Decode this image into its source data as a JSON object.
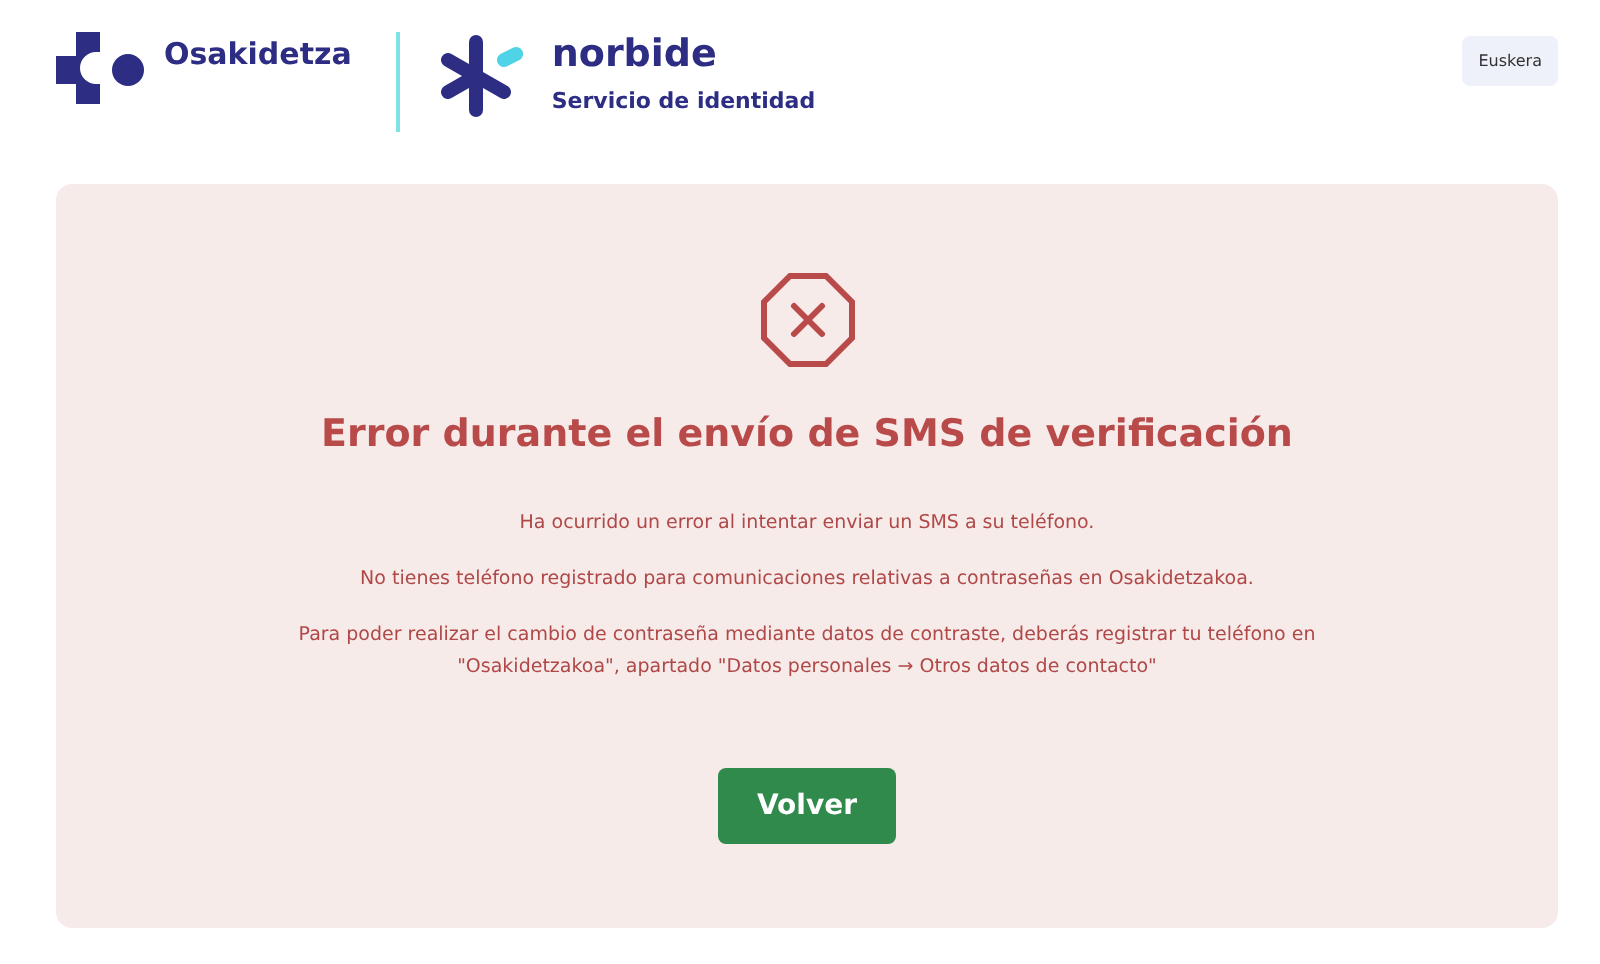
{
  "header": {
    "brand": "Osakidetza",
    "product": "norbide",
    "product_subtitle": "Servicio de identidad",
    "language_button": "Euskera"
  },
  "error": {
    "title": "Error durante el envío de SMS de verificación",
    "messages": [
      "Ha ocurrido un error al intentar enviar un SMS a su teléfono.",
      "No tienes teléfono registrado para comunicaciones relativas a contraseñas en Osakidetzakoa.",
      "Para poder realizar el cambio de contraseña mediante datos de contraste, deberás registrar tu teléfono en \"Osakidetzakoa\", apartado \"Datos personales → Otros datos de contacto\""
    ],
    "button": "Volver"
  }
}
